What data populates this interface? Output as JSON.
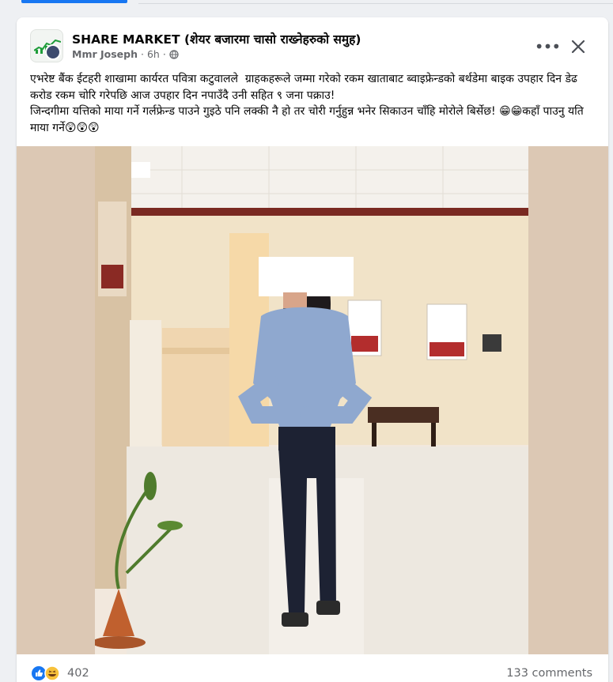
{
  "post": {
    "group_name": "SHARE MARKET (शेयर बजारमा चासो राख्नेहरुको समुह)",
    "author": "Mmr Joseph",
    "time": "6h",
    "privacy_icon": "globe-icon",
    "text_line_1": "एभरेष्ट बैंक ईटहरी शाखामा कार्यरत पवित्रा कटुवालले  ग्राहकहरूले जम्मा गरेको रकम खाताबाट ब्वाइफ्रेन्डको बर्थडेमा बाइक उपहार दिन डेढ करोड रकम चोरि गरेपछि आज उपहार दिन नपाउँदै उनी सहित ९ जना पक्राउ!",
    "text_line_2": "जिन्दगीमा यत्तिको माया गर्ने गर्लफ्रेन्ड पाउने गुइठे पनि लक्की नै हो तर चोरी गर्नुहुन्न भनेर सिकाउन चाँहि मोरोले बिर्सेछ! 😁😁कहाँ पाउनु यति माया गर्ने😲😲😲"
  },
  "controls": {
    "more_icon": "more-options-icon",
    "close_icon": "close-icon"
  },
  "stats": {
    "reaction_icons": [
      "like-icon",
      "haha-icon"
    ],
    "reaction_count": "402",
    "comments": "133 comments"
  },
  "colors": {
    "accent": "#1877f2",
    "text": "#050505",
    "secondary_text": "#65676b",
    "card": "#ffffff",
    "background": "#eef0f3"
  }
}
